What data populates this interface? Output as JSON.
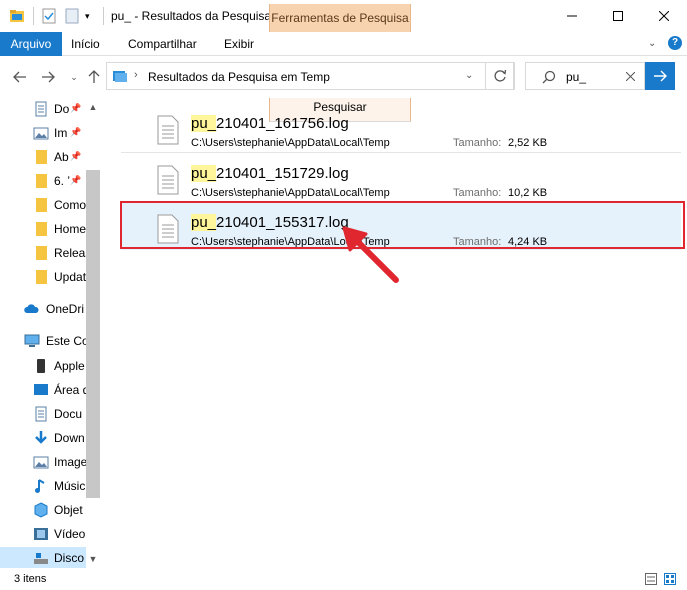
{
  "window": {
    "title": "pu_ - Resultados da Pesquisa...",
    "context_tab": "Ferramentas de Pesquisa"
  },
  "ribbon": {
    "tabs": [
      "Arquivo",
      "Início",
      "Compartilhar",
      "Exibir",
      "Pesquisar"
    ]
  },
  "address": {
    "path": "Resultados da Pesquisa em Temp"
  },
  "search": {
    "value": "pu_"
  },
  "sidebar": {
    "items": [
      {
        "label": "Do",
        "icon": "document-icon",
        "pinned": true
      },
      {
        "label": "Im",
        "icon": "pictures-icon",
        "pinned": true
      },
      {
        "label": "Ab",
        "icon": "folder-icon",
        "pinned": true
      },
      {
        "label": "6. ʼ",
        "icon": "folder-icon",
        "pinned": true
      },
      {
        "label": "Como",
        "icon": "folder-icon",
        "pinned": false
      },
      {
        "label": "Home",
        "icon": "folder-icon",
        "pinned": false
      },
      {
        "label": "Releas",
        "icon": "folder-icon",
        "pinned": false
      },
      {
        "label": "Updat",
        "icon": "folder-icon",
        "pinned": false
      },
      {
        "label": "OneDri",
        "icon": "cloud-icon",
        "pinned": false
      },
      {
        "label": "Este Co",
        "icon": "computer-icon",
        "pinned": false
      },
      {
        "label": "Apple",
        "icon": "phone-icon",
        "pinned": false
      },
      {
        "label": "Área d",
        "icon": "desktop-icon",
        "pinned": false
      },
      {
        "label": "Docu",
        "icon": "document-icon",
        "pinned": false
      },
      {
        "label": "Down",
        "icon": "download-icon",
        "pinned": false
      },
      {
        "label": "Image",
        "icon": "pictures-icon",
        "pinned": false
      },
      {
        "label": "Músic",
        "icon": "music-icon",
        "pinned": false
      },
      {
        "label": "Objet",
        "icon": "3d-objects-icon",
        "pinned": false
      },
      {
        "label": "Vídeo",
        "icon": "video-icon",
        "pinned": false
      },
      {
        "label": "Disco",
        "icon": "drive-icon",
        "pinned": false
      }
    ]
  },
  "results": [
    {
      "match": "pu_",
      "rest": "210401_161756.log",
      "path": "C:\\Users\\stephanie\\AppData\\Local\\Temp",
      "size_label": "Tamanho:",
      "size": "2,52 KB",
      "selected": false
    },
    {
      "match": "pu_",
      "rest": "210401_151729.log",
      "path": "C:\\Users\\stephanie\\AppData\\Local\\Temp",
      "size_label": "Tamanho:",
      "size": "10,2 KB",
      "selected": false
    },
    {
      "match": "pu_",
      "rest": "210401_155317.log",
      "path": "C:\\Users\\stephanie\\AppData\\Local\\Temp",
      "size_label": "Tamanho:",
      "size": "4,24 KB",
      "selected": true
    }
  ],
  "status": {
    "count": "3 itens"
  },
  "colors": {
    "accent": "#1979ca",
    "context_tab": "#f8d3b0",
    "selection": "#e5f1fb",
    "highlight": "#fff59a",
    "annotation": "#e0272f"
  }
}
